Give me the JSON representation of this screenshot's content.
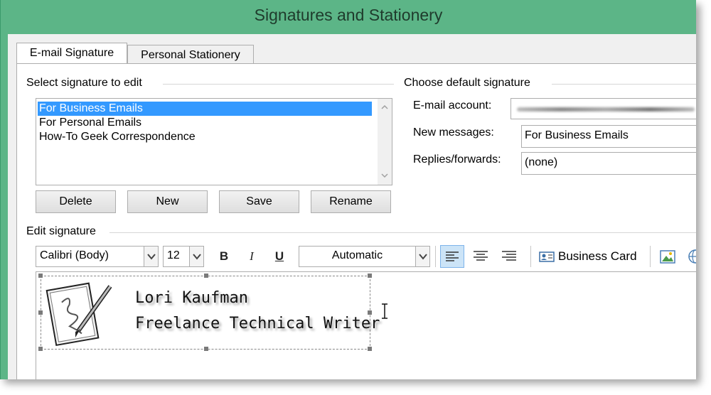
{
  "window": {
    "title": "Signatures and Stationery"
  },
  "tabs": [
    {
      "label": "E-mail Signature",
      "active": true
    },
    {
      "label": "Personal Stationery",
      "active": false
    }
  ],
  "select_section": {
    "label": "Select signature to edit",
    "items": [
      "For Business Emails",
      "For Personal Emails",
      "How-To Geek Correspondence"
    ],
    "selected_index": 0
  },
  "buttons": {
    "delete": "Delete",
    "new": "New",
    "save": "Save",
    "rename": "Rename"
  },
  "default_section": {
    "label": "Choose default signature",
    "email_account_label": "E-mail account:",
    "new_messages_label": "New messages:",
    "new_messages_value": "For Business Emails",
    "replies_label": "Replies/forwards:",
    "replies_value": "(none)"
  },
  "edit_section": {
    "label": "Edit signature",
    "font": "Calibri (Body)",
    "size": "12",
    "bold": "B",
    "italic": "I",
    "underline": "U",
    "color": "Automatic",
    "business_card": "Business Card"
  },
  "signature": {
    "name": "Lori Kaufman",
    "title": "Freelance Technical Writer"
  },
  "colors": {
    "titlebar": "#5cb587",
    "selection": "#3399ff",
    "align_active": "#cce4f7"
  }
}
